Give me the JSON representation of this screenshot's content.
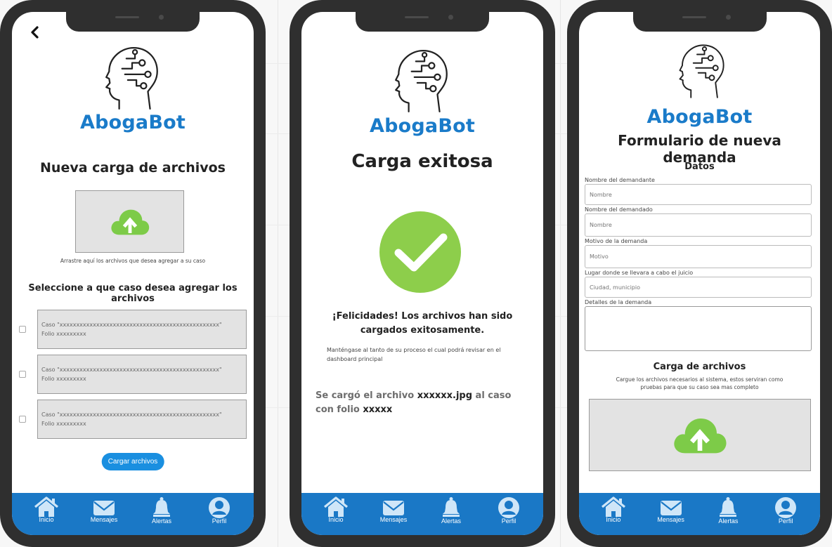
{
  "brand": {
    "name": "AbogaBot",
    "color": "#1a7bc9"
  },
  "colors": {
    "nav_bg": "#1a78c6",
    "upload_green": "#7dcb48",
    "success_green": "#8dce4b",
    "button_blue": "#1a8fe0"
  },
  "nav": [
    {
      "label": "Inicio",
      "icon": "home-icon"
    },
    {
      "label": "Mensajes",
      "icon": "envelope-icon"
    },
    {
      "label": "Alertas",
      "icon": "bell-icon"
    },
    {
      "label": "Perfil",
      "icon": "user-icon"
    }
  ],
  "screen1": {
    "title": "Nueva carga de archivos",
    "drop_hint": "Arrastre aquí los archivos que desea agregar a su caso",
    "select_title": "Seleccione a que caso desea agregar los archivos",
    "cases": [
      {
        "case_text": "Caso \"xxxxxxxxxxxxxxxxxxxxxxxxxxxxxxxxxxxxxxxxxxxxxxxx\"",
        "folio": "Folio xxxxxxxxx"
      },
      {
        "case_text": "Caso \"xxxxxxxxxxxxxxxxxxxxxxxxxxxxxxxxxxxxxxxxxxxxxxxx\"",
        "folio": "Folio xxxxxxxxx"
      },
      {
        "case_text": "Caso \"xxxxxxxxxxxxxxxxxxxxxxxxxxxxxxxxxxxxxxxxxxxxxxxx\"",
        "folio": "Folio xxxxxxxxx"
      }
    ],
    "upload_button": "Cargar archivos"
  },
  "screen2": {
    "title": "Carga exitosa",
    "message": "¡Felicidades! Los archivos han sido cargados exitosamente.",
    "subtext": "Manténgase al tanto de su proceso el cual podrá revisar en el dashboard principal",
    "result_prefix": "Se cargó el archivo ",
    "file_name": "xxxxxx.jpg",
    "result_middle": " al caso con folio ",
    "folio": "xxxxx"
  },
  "screen3": {
    "title": "Formulario de nueva demanda",
    "section_title": "Datos",
    "fields": [
      {
        "label": "Nombre del demandante",
        "placeholder": "Nombre"
      },
      {
        "label": "Nombre del demandado",
        "placeholder": "Nombre"
      },
      {
        "label": "Motivo de la demanda",
        "placeholder": "Motivo"
      },
      {
        "label": "Lugar donde se llevara a cabo el juicio",
        "placeholder": "Ciudad, municipio"
      }
    ],
    "details_label": "Detalles de la demanda",
    "upload_title": "Carga de archivos",
    "upload_desc": "Cargue los archivos necesarios al sistema, estos serviran como pruebas para que su caso sea mas completo"
  }
}
